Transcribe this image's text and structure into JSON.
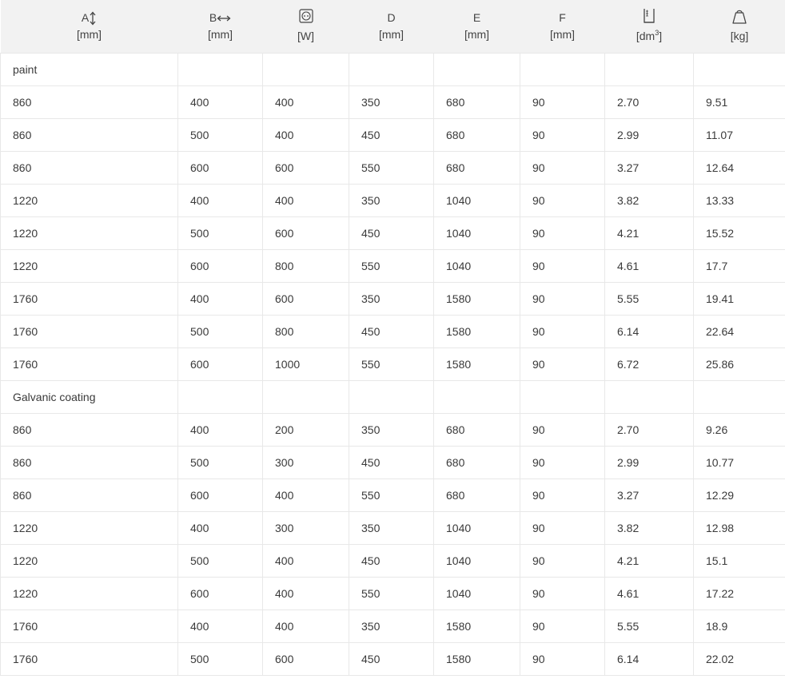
{
  "table": {
    "headers": [
      {
        "letter": "A",
        "unit": "[mm]",
        "icon": "vertical-arrow-icon"
      },
      {
        "letter": "B",
        "unit": "[mm]",
        "icon": "horizontal-arrow-icon"
      },
      {
        "letter": "",
        "unit": "[W]",
        "icon": "power-socket-icon"
      },
      {
        "letter": "D",
        "unit": "[mm]",
        "icon": ""
      },
      {
        "letter": "E",
        "unit": "[mm]",
        "icon": ""
      },
      {
        "letter": "F",
        "unit": "[mm]",
        "icon": ""
      },
      {
        "letter": "",
        "unit_base": "[dm",
        "unit_exp": "3",
        "unit_end": "]",
        "icon": "water-volume-icon"
      },
      {
        "letter": "",
        "unit": "[kg]",
        "icon": "weight-icon"
      }
    ],
    "sections": [
      {
        "label": "paint",
        "rows": [
          [
            "860",
            "400",
            "400",
            "350",
            "680",
            "90",
            "2.70",
            "9.51"
          ],
          [
            "860",
            "500",
            "400",
            "450",
            "680",
            "90",
            "2.99",
            "11.07"
          ],
          [
            "860",
            "600",
            "600",
            "550",
            "680",
            "90",
            "3.27",
            "12.64"
          ],
          [
            "1220",
            "400",
            "400",
            "350",
            "1040",
            "90",
            "3.82",
            "13.33"
          ],
          [
            "1220",
            "500",
            "600",
            "450",
            "1040",
            "90",
            "4.21",
            "15.52"
          ],
          [
            "1220",
            "600",
            "800",
            "550",
            "1040",
            "90",
            "4.61",
            "17.7"
          ],
          [
            "1760",
            "400",
            "600",
            "350",
            "1580",
            "90",
            "5.55",
            "19.41"
          ],
          [
            "1760",
            "500",
            "800",
            "450",
            "1580",
            "90",
            "6.14",
            "22.64"
          ],
          [
            "1760",
            "600",
            "1000",
            "550",
            "1580",
            "90",
            "6.72",
            "25.86"
          ]
        ]
      },
      {
        "label": "Galvanic coating",
        "rows": [
          [
            "860",
            "400",
            "200",
            "350",
            "680",
            "90",
            "2.70",
            "9.26"
          ],
          [
            "860",
            "500",
            "300",
            "450",
            "680",
            "90",
            "2.99",
            "10.77"
          ],
          [
            "860",
            "600",
            "400",
            "550",
            "680",
            "90",
            "3.27",
            "12.29"
          ],
          [
            "1220",
            "400",
            "300",
            "350",
            "1040",
            "90",
            "3.82",
            "12.98"
          ],
          [
            "1220",
            "500",
            "400",
            "450",
            "1040",
            "90",
            "4.21",
            "15.1"
          ],
          [
            "1220",
            "600",
            "400",
            "550",
            "1040",
            "90",
            "4.61",
            "17.22"
          ],
          [
            "1760",
            "400",
            "400",
            "350",
            "1580",
            "90",
            "5.55",
            "18.9"
          ],
          [
            "1760",
            "500",
            "600",
            "450",
            "1580",
            "90",
            "6.14",
            "22.02"
          ]
        ]
      }
    ]
  }
}
